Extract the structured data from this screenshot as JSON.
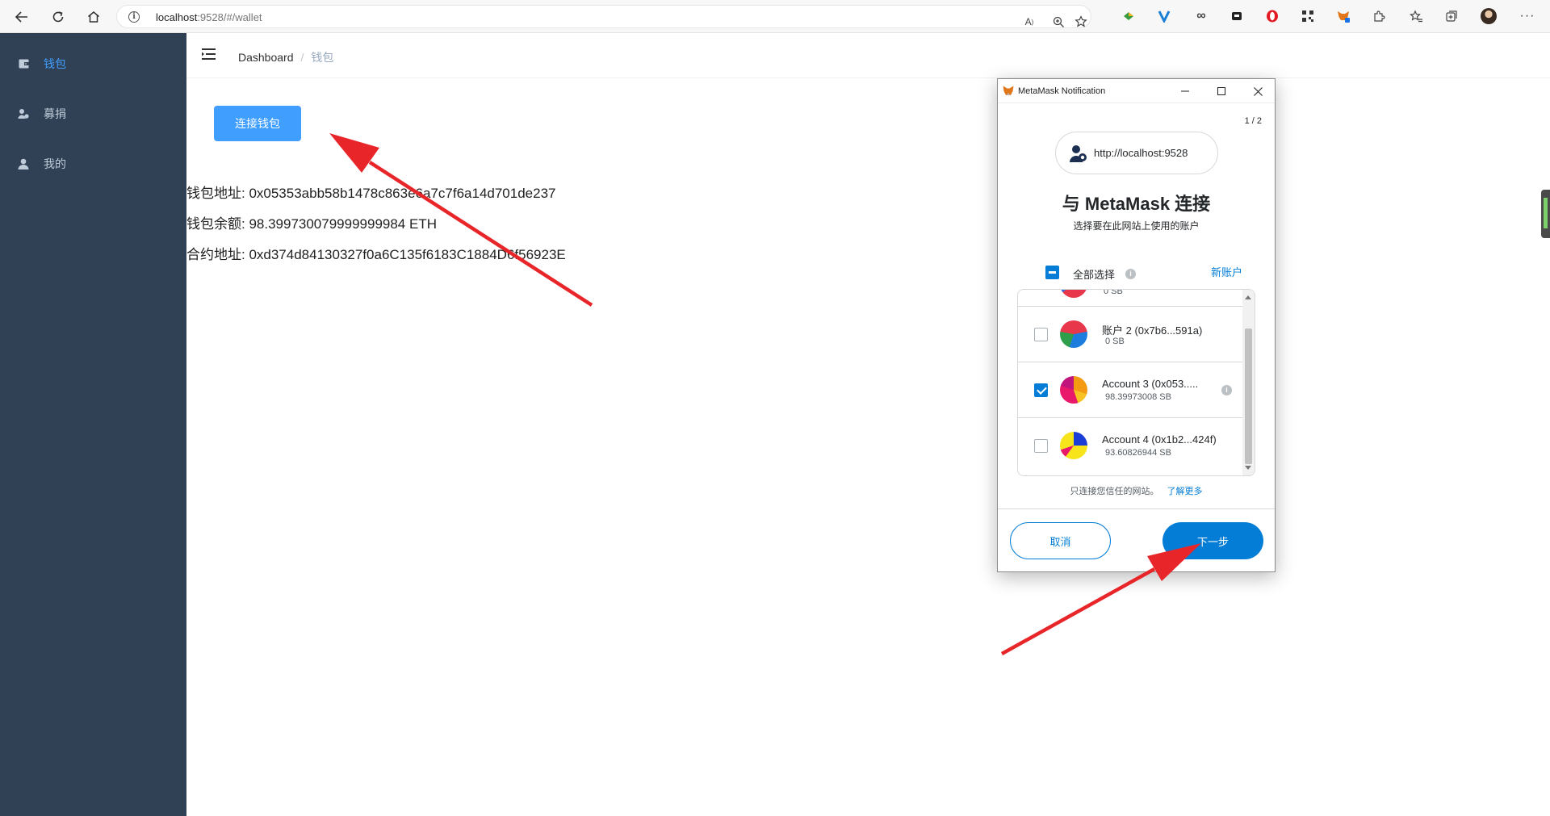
{
  "browser": {
    "url_host": "localhost",
    "url_rest": ":9528/#/wallet"
  },
  "sidebar": {
    "items": [
      {
        "label": "钱包",
        "icon": "wallet-icon",
        "active": true
      },
      {
        "label": "募捐",
        "icon": "donate-icon",
        "active": false
      },
      {
        "label": "我的",
        "icon": "user-icon",
        "active": false
      }
    ],
    "background": "#304156",
    "active_color": "#409eff"
  },
  "navbar": {
    "breadcrumb": [
      "Dashboard",
      "钱包"
    ],
    "separator": "/"
  },
  "main": {
    "connect_button": "连接钱包",
    "wallet_address_line": "钱包地址: 0x05353abb58b1478c863e6a7c7f6a14d701de237",
    "wallet_balance_line": "钱包余额: 98.399730079999999984 ETH",
    "contract_address_line": "合约地址: 0xd374d84130327f0a6C135f6183C1884D6f56923E"
  },
  "metamask": {
    "window_title": "MetaMask Notification",
    "page_indicator": "1 / 2",
    "origin": "http://localhost:9528",
    "heading": "与 MetaMask 连接",
    "subheading": "选择要在此网站上使用的账户",
    "select_all_label": "全部选择",
    "new_account_link": "新账户",
    "partial_row_text": "0 SB",
    "accounts": [
      {
        "name": "账户 2 (0x7b6...591a)",
        "balance": "0 SB",
        "checked": false
      },
      {
        "name": "Account 3 (0x053.....",
        "balance": "98.39973008 SB",
        "checked": true
      },
      {
        "name": "Account 4 (0x1b2...424f)",
        "balance": "93.60826944 SB",
        "checked": false
      }
    ],
    "trust_text": "只连接您信任的网站。",
    "learn_more_link": "了解更多",
    "cancel_button": "取消",
    "next_button": "下一步",
    "accent": "#037dd6"
  },
  "annotation_color": "#e8262a"
}
